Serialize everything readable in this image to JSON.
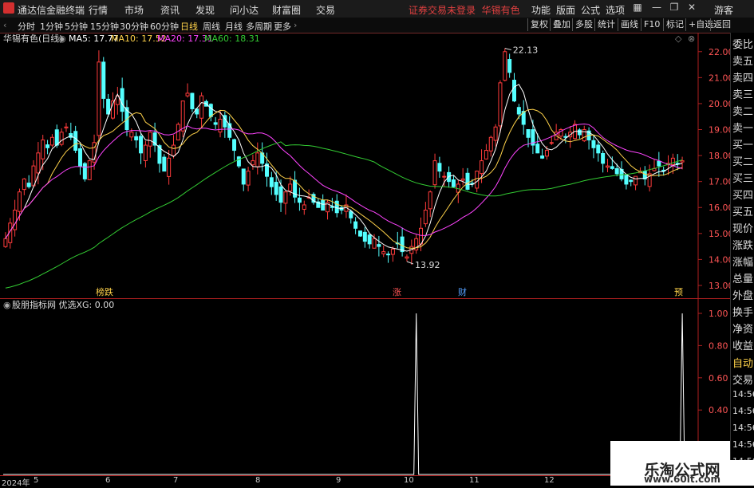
{
  "app": {
    "name": "通达信金融终端"
  },
  "menus": [
    "行情",
    "市场",
    "资讯",
    "发现",
    "问小达",
    "财富圈",
    "交易"
  ],
  "notice": "证券交易未登录",
  "stock_name_top": "华锡有色",
  "right_menus": [
    "功能",
    "版面",
    "公式",
    "选项"
  ],
  "guest": "游客",
  "periods": [
    "分时",
    "1分钟",
    "5分钟",
    "15分钟",
    "30分钟",
    "60分钟",
    "日线",
    "周线",
    "月线",
    "多周期",
    "更多"
  ],
  "active_period": "日线",
  "right_tools": [
    "复权",
    "叠加",
    "多股",
    "统计",
    "画线",
    "F10",
    "标记",
    "+自选",
    "返回"
  ],
  "main_header": {
    "title": "华锡有色(日线)",
    "ma5": "MA5: 17.77",
    "ma10": "MA10: 17.52",
    "ma20": "MA20: 17.31",
    "ma60": "MA60: 18.31"
  },
  "colors": {
    "up": "#ff3b3b",
    "down": "#54ffff",
    "ma5": "#ffffff",
    "ma10": "#ffd24a",
    "ma20": "#ff44ff",
    "ma60": "#33cc33"
  },
  "price_axis": [
    "22.00",
    "21.00",
    "20.00",
    "19.00",
    "18.00",
    "17.00",
    "16.00",
    "15.00",
    "14.00",
    "13.00"
  ],
  "annotations": {
    "high": "22.13",
    "low": "13.92"
  },
  "event_markers": [
    "榜跌",
    "涨",
    "财",
    "预"
  ],
  "sub_header": "股朋指标网 优选XG: 0.00",
  "sub_axis": [
    "1.00",
    "0.80",
    "0.60",
    "0.40"
  ],
  "right_panel": [
    "委比",
    "卖五",
    "卖四",
    "卖三",
    "卖二",
    "卖一",
    "买一",
    "买二",
    "买三",
    "买四",
    "买五",
    "现价",
    "涨跌",
    "涨幅",
    "总量",
    "外盘",
    "换手",
    "净资",
    "收益",
    "自动",
    "交易",
    "14:56",
    "14:56",
    "14:56",
    "14:56",
    "14:56",
    "14:56",
    "14:56"
  ],
  "date_axis": [
    "2024年",
    "5",
    "6",
    "7",
    "8",
    "9",
    "10",
    "11",
    "12"
  ],
  "watermark": {
    "title": "乐淘公式网",
    "url": "www.60lt.com"
  },
  "chart_data": [
    {
      "type": "candlestick",
      "title": "华锡有色(日线)",
      "ylim": [
        12.6,
        22.3
      ],
      "highlights": {
        "max": 22.13,
        "min": 13.92
      },
      "closes": [
        14.8,
        15.4,
        15.9,
        16.6,
        17.1,
        16.8,
        17.6,
        18.1,
        18.6,
        18.3,
        18.7,
        18.4,
        18.9,
        19.1,
        18.7,
        18.2,
        17.6,
        17.1,
        17.8,
        18.5,
        21.6,
        20.2,
        19.6,
        20.1,
        20.3,
        19.7,
        19.0,
        18.9,
        18.6,
        18.1,
        18.4,
        18.9,
        18.4,
        17.7,
        17.4,
        17.9,
        18.4,
        19.2,
        20.1,
        20.4,
        19.8,
        19.6,
        20.3,
        19.9,
        19.5,
        19.2,
        19.4,
        19.1,
        18.7,
        18.2,
        17.6,
        16.9,
        17.4,
        17.8,
        18.1,
        17.7,
        17.2,
        16.8,
        16.5,
        16.2,
        16.6,
        16.9,
        16.4,
        16.2,
        16.1,
        16.4,
        16.2,
        16.0,
        15.9,
        16.2,
        16.0,
        15.8,
        15.9,
        16.1,
        15.6,
        15.2,
        14.9,
        14.7,
        14.6,
        14.8,
        14.5,
        14.3,
        14.2,
        14.4,
        14.6,
        14.3,
        14.1,
        14.5,
        14.8,
        15.2,
        15.9,
        16.6,
        17.8,
        17.4,
        17.2,
        17.0,
        16.8,
        16.9,
        17.1,
        16.7,
        16.9,
        17.4,
        17.8,
        18.2,
        18.7,
        19.1,
        20.8,
        22.0,
        21.2,
        20.1,
        19.6,
        19.2,
        18.7,
        18.4,
        18.1,
        17.9,
        18.2,
        18.5,
        18.9,
        19.0,
        18.7,
        18.9,
        19.2,
        18.8,
        19.0,
        18.6,
        18.3,
        18.1,
        17.7,
        17.6,
        17.5,
        17.3,
        17.1,
        16.9,
        17.0,
        17.2,
        17.4,
        17.1,
        17.3,
        17.5,
        17.6,
        17.4,
        17.7,
        17.9,
        17.7,
        17.8
      ],
      "ma5_last": 17.77,
      "ma10_last": 17.52,
      "ma20_last": 17.31,
      "ma60_last": 18.31
    },
    {
      "type": "line",
      "title": "优选XG",
      "ylim": [
        0,
        1.0
      ],
      "spikes": [
        {
          "index": 88,
          "value": 1.0
        },
        {
          "index": 145,
          "value": 1.0
        }
      ]
    }
  ]
}
